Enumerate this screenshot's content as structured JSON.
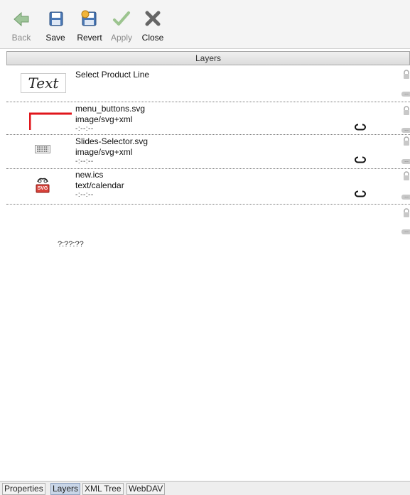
{
  "toolbar": {
    "back": {
      "label": "Back",
      "icon": "back-arrow-icon",
      "enabled": false
    },
    "save": {
      "label": "Save",
      "icon": "floppy-disk-icon",
      "enabled": true
    },
    "revert": {
      "label": "Revert",
      "icon": "revert-icon",
      "enabled": true
    },
    "apply": {
      "label": "Apply",
      "icon": "checkmark-icon",
      "enabled": false
    },
    "close": {
      "label": "Close",
      "icon": "close-x-icon",
      "enabled": true
    }
  },
  "panel": {
    "title": "Layers"
  },
  "layers": [
    {
      "thumbnail": "text-thumbnail",
      "thumb_text": "Text",
      "name": "Select Product Line",
      "mime": "",
      "date": "",
      "has_link": false
    },
    {
      "thumbnail": "red-corner-thumbnail",
      "name": "menu_buttons.svg",
      "mime": "image/svg+xml",
      "date": "-:--:--",
      "has_link": true
    },
    {
      "thumbnail": "grid-thumbnail",
      "name": "Slides-Selector.svg",
      "mime": "image/svg+xml",
      "date": "-:--:--",
      "has_link": true
    },
    {
      "thumbnail": "svg-file-thumbnail",
      "thumb_text": "SVG",
      "name": "new.ics",
      "mime": "text/calendar",
      "date": "-:--:--",
      "has_link": true
    }
  ],
  "empty_row": {
    "date": "?:??:??"
  },
  "tabs": [
    {
      "label": "Properties",
      "active": false
    },
    {
      "label": "Layers",
      "active": true
    },
    {
      "label": "XML Tree",
      "active": false
    },
    {
      "label": "WebDAV",
      "active": false
    }
  ],
  "colors": {
    "accent_red": "#e0161b",
    "tab_active": "#c9d6e8",
    "toolbar_bg": "#f4f4f4"
  }
}
